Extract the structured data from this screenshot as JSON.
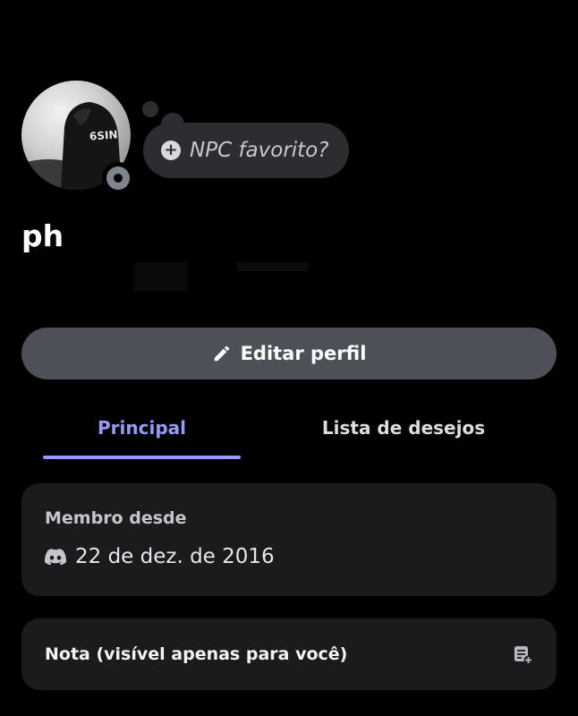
{
  "profile": {
    "username": "ph",
    "status_prompt": "NPC favorito?"
  },
  "actions": {
    "edit_profile": "Editar perfil"
  },
  "tabs": [
    {
      "label": "Principal",
      "active": true
    },
    {
      "label": "Lista de desejos",
      "active": false
    }
  ],
  "member_card": {
    "heading": "Membro desde",
    "date": "22 de dez. de 2016",
    "icon": "discord-icon"
  },
  "note_card": {
    "label": "Nota (visível apenas para você)",
    "icon": "note-add-icon"
  },
  "colors": {
    "background": "#000000",
    "accent": "#949cf7",
    "button": "#4e5058",
    "card": "#1b1b1e"
  }
}
